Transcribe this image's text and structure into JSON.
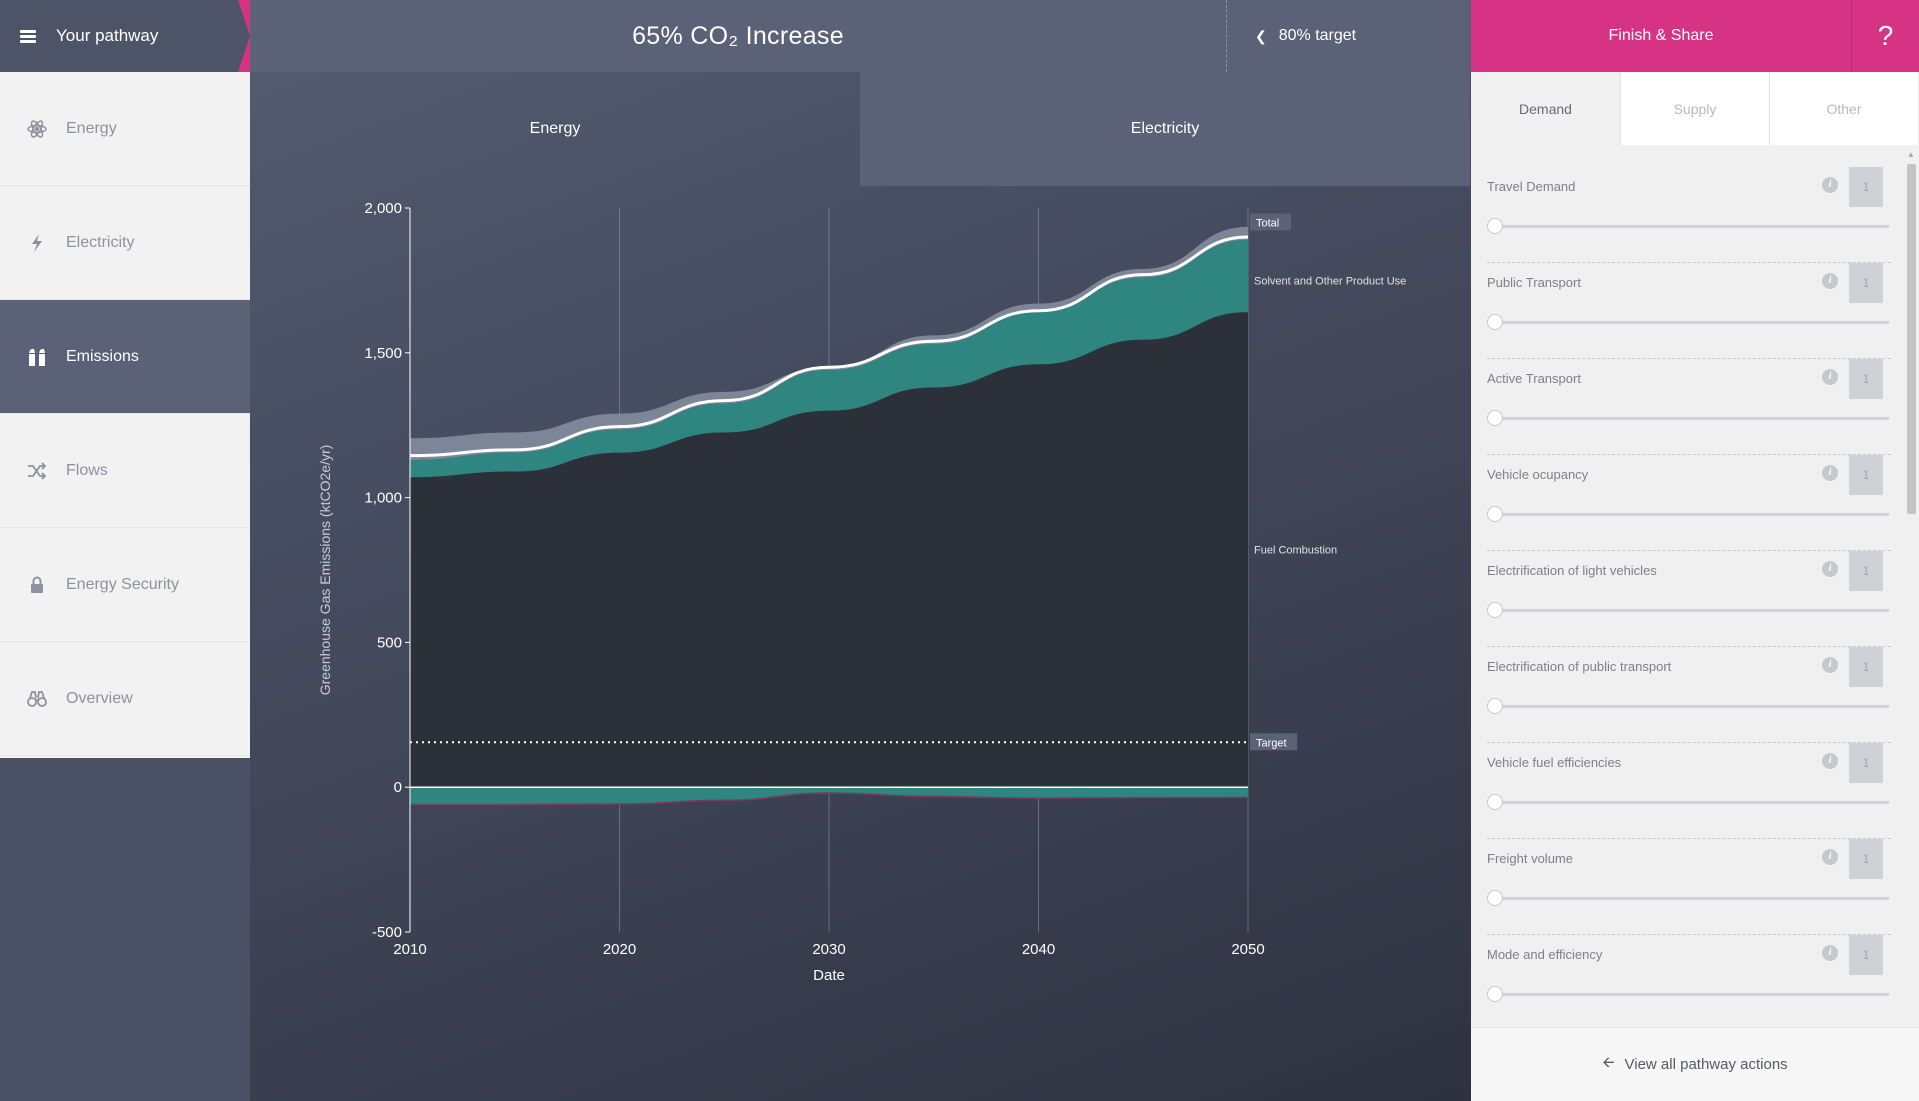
{
  "header": {
    "pathway_label": "Your pathway",
    "headline": "65% CO₂ Increase",
    "target_label": "80% target",
    "finish_label": "Finish & Share",
    "help_label": "?"
  },
  "sidebar": {
    "items": [
      {
        "label": "Energy",
        "icon": "atom-icon"
      },
      {
        "label": "Electricity",
        "icon": "lightning-icon"
      },
      {
        "label": "Emissions",
        "icon": "factory-icon"
      },
      {
        "label": "Flows",
        "icon": "shuffle-icon"
      },
      {
        "label": "Energy Security",
        "icon": "lock-icon"
      },
      {
        "label": "Overview",
        "icon": "binoculars-icon"
      }
    ],
    "active_index": 2
  },
  "main": {
    "tabs": [
      {
        "label": "Energy",
        "active": true
      },
      {
        "label": "Electricity",
        "active": false
      }
    ]
  },
  "chart_data": {
    "type": "area",
    "xlabel": "Date",
    "ylabel": "Greenhouse Gas Emissions (ktCO2e/yr)",
    "ylim": [
      -500,
      2000
    ],
    "xlim": [
      2010,
      2050
    ],
    "xticks": [
      2010,
      2020,
      2030,
      2040,
      2050
    ],
    "yticks": [
      -500,
      0,
      500,
      1000,
      1500,
      2000
    ],
    "ytick_labels": [
      "-500",
      "0",
      "500",
      "1,000",
      "1,500",
      "2,000"
    ],
    "grid": "vertical",
    "x": [
      2010,
      2015,
      2020,
      2025,
      2030,
      2035,
      2040,
      2045,
      2050
    ],
    "series": [
      {
        "name": "Fuel Combustion",
        "color": "#2c3038",
        "base": [
          1070,
          1090,
          1155,
          1225,
          1300,
          1380,
          1460,
          1545,
          1640
        ]
      },
      {
        "name": "",
        "color": "#2f8580",
        "top": [
          1130,
          1155,
          1235,
          1325,
          1440,
          1530,
          1640,
          1760,
          1890
        ]
      },
      {
        "name": "Solvent and Other Product Use",
        "color": "#7d8598",
        "top": [
          1205,
          1225,
          1290,
          1365,
          1450,
          1560,
          1670,
          1790,
          1935
        ]
      },
      {
        "name": "",
        "color": "#2f8580",
        "negative": [
          -60,
          -60,
          -58,
          -45,
          -20,
          -32,
          -38,
          -36,
          -35
        ]
      }
    ],
    "total": {
      "name": "Total",
      "values": [
        1145,
        1165,
        1245,
        1335,
        1450,
        1540,
        1645,
        1770,
        1900
      ]
    },
    "target": {
      "name": "Target",
      "value": 155
    },
    "labels": {
      "total": "Total",
      "solvent": "Solvent and Other Product Use",
      "fuel": "Fuel Combustion",
      "target": "Target"
    }
  },
  "panel": {
    "tabs": [
      {
        "label": "Demand",
        "active": true
      },
      {
        "label": "Supply",
        "active": false
      },
      {
        "label": "Other",
        "active": false
      }
    ],
    "levers": [
      {
        "label": "Travel Demand",
        "value": "1",
        "level": 0
      },
      {
        "label": "Public Transport",
        "value": "1",
        "level": 0
      },
      {
        "label": "Active Transport",
        "value": "1",
        "level": 0
      },
      {
        "label": "Vehicle ocupancy",
        "value": "1",
        "level": 0
      },
      {
        "label": "Electrification of light vehicles",
        "value": "1",
        "level": 0
      },
      {
        "label": "Electrification of public transport",
        "value": "1",
        "level": 0
      },
      {
        "label": "Vehicle fuel efficiencies",
        "value": "1",
        "level": 0
      },
      {
        "label": "Freight volume",
        "value": "1",
        "level": 0
      },
      {
        "label": "Mode and efficiency",
        "value": "1",
        "level": 0
      }
    ],
    "view_all_label": "View all pathway actions"
  }
}
